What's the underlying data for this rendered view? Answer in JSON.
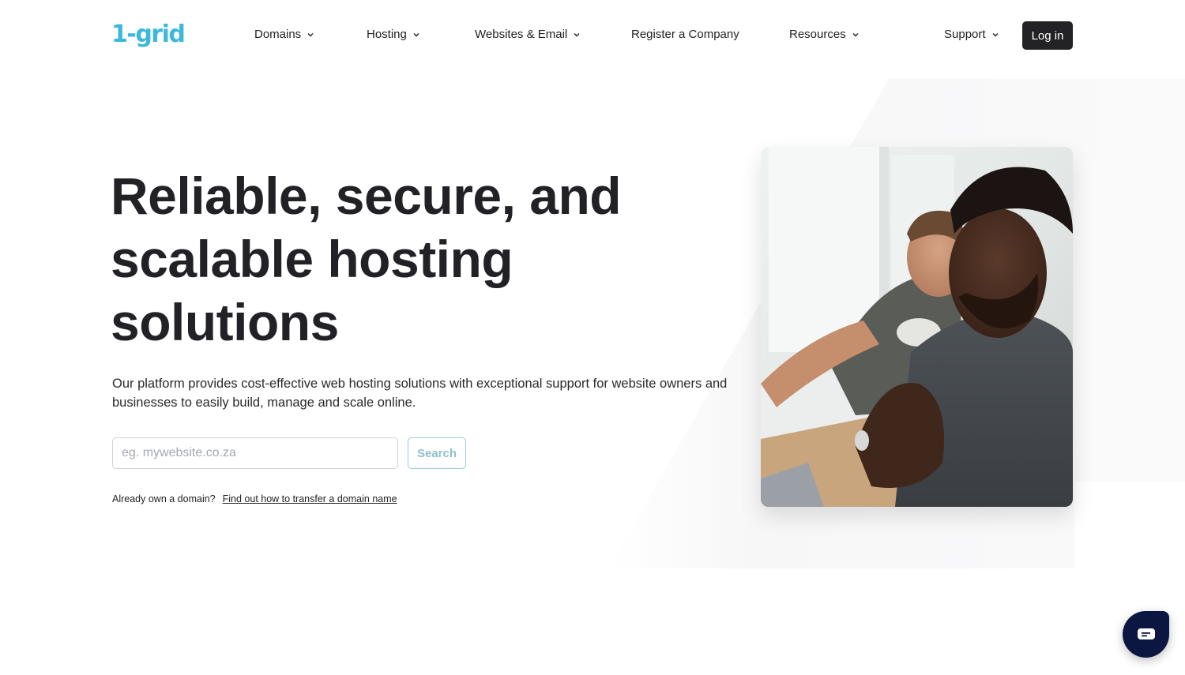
{
  "brand": {
    "logo_text": "1-grid",
    "accent": "#3cb8db"
  },
  "nav": {
    "items": [
      {
        "label": "Domains",
        "has_dropdown": true
      },
      {
        "label": "Hosting",
        "has_dropdown": true
      },
      {
        "label": "Websites & Email",
        "has_dropdown": true
      },
      {
        "label": "Register a Company",
        "has_dropdown": false
      },
      {
        "label": "Resources",
        "has_dropdown": true
      },
      {
        "label": "Support",
        "has_dropdown": true
      }
    ],
    "login_label": "Log in"
  },
  "hero": {
    "title_lines": [
      "Reliable, secure, and",
      "scalable hosting",
      "solutions"
    ],
    "subtitle": "Our platform provides cost-effective web hosting solutions with exceptional support for website owners and businesses to easily build, manage and scale online.",
    "search": {
      "placeholder": "eg. mywebsite.co.za",
      "value": "",
      "button_label": "Search"
    },
    "transfer": {
      "prompt": "Already own a domain?",
      "link_text": "Find out how to transfer a domain name"
    },
    "image_alt": "Two men looking at a laptop in an office"
  },
  "chat": {
    "icon": "chat-bubble-icon"
  }
}
